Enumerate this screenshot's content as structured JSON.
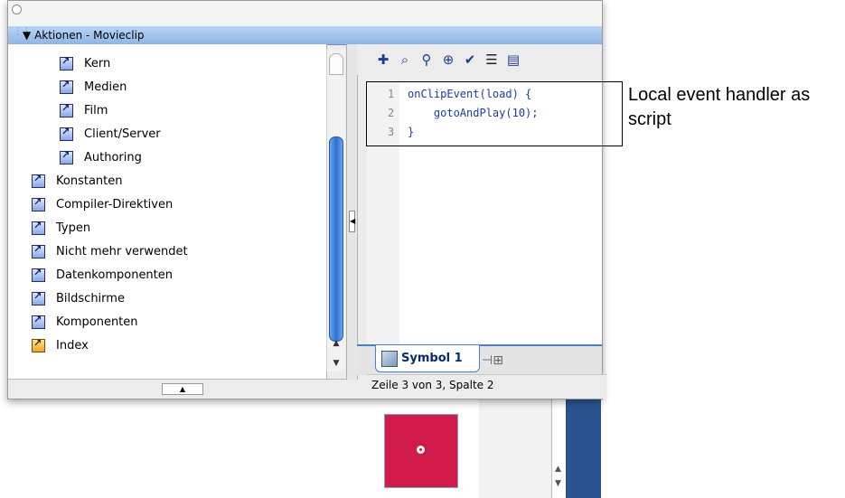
{
  "panel": {
    "title": "Aktionen - Movieclip"
  },
  "tree": {
    "items": [
      {
        "label": "Kern"
      },
      {
        "label": "Medien"
      },
      {
        "label": "Film"
      },
      {
        "label": "Client/Server"
      },
      {
        "label": "Authoring"
      },
      {
        "label": "Konstanten"
      },
      {
        "label": "Compiler-Direktiven"
      },
      {
        "label": "Typen"
      },
      {
        "label": "Nicht mehr verwendet"
      },
      {
        "label": "Datenkomponenten"
      },
      {
        "label": "Bildschirme"
      },
      {
        "label": "Komponenten"
      },
      {
        "label": "Index"
      }
    ]
  },
  "editor": {
    "lines": [
      {
        "num": "1",
        "code": "onClipEvent(load) {"
      },
      {
        "num": "2",
        "code": "    gotoAndPlay(10);"
      },
      {
        "num": "3",
        "code": "}"
      }
    ]
  },
  "tabs": {
    "symbol_label": "Symbol 1"
  },
  "status": {
    "text": "Zeile 3 von 3, Spalte 2"
  },
  "annotation": {
    "text": "Local event handler as script"
  },
  "colors": {
    "code": "#1a3ea0",
    "header": "#a6c8ef",
    "stage_clip": "#d01a49",
    "thumb": "#2e6ed0"
  },
  "icons": [
    "add-statement-icon",
    "find-icon",
    "replace-icon",
    "target-path-icon",
    "check-syntax-icon",
    "auto-format-icon",
    "code-hint-icon"
  ]
}
